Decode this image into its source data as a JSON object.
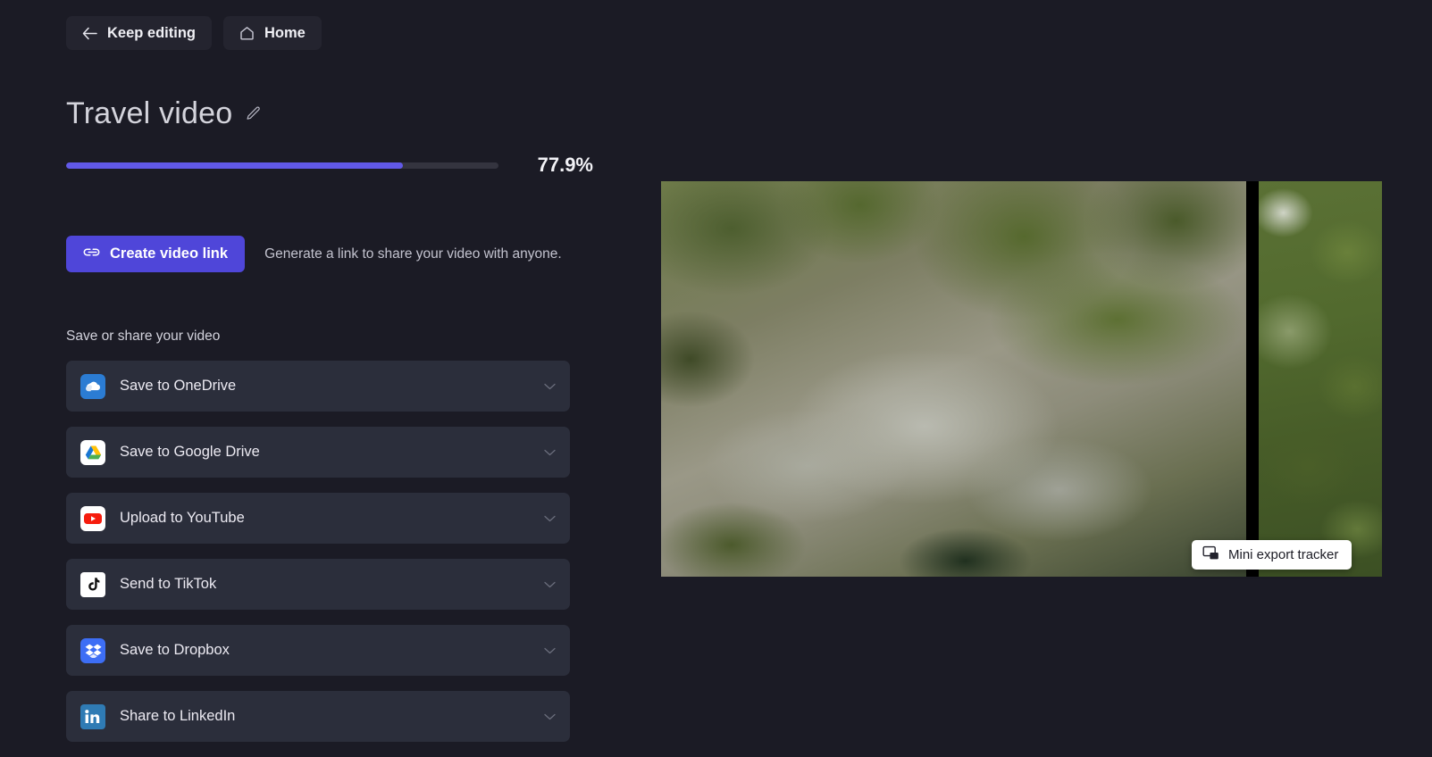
{
  "topbar": {
    "buttons": [
      {
        "label": "Keep editing",
        "icon": "arrow-left-icon"
      },
      {
        "label": "Home",
        "icon": "home-icon"
      }
    ]
  },
  "project": {
    "title": "Travel video",
    "edit_icon": "pencil-icon"
  },
  "progress": {
    "percent_label": "77.9%",
    "percent_value": 77.9,
    "fill_color": "#6159e8",
    "track_color": "#34343f"
  },
  "share_link": {
    "button_label": "Create video link",
    "button_icon": "link-icon",
    "button_color": "#4f46d9",
    "description": "Generate a link to share your video with anyone."
  },
  "share_section": {
    "label": "Save or share your video",
    "items": [
      {
        "label": "Save to OneDrive",
        "icon": "onedrive-icon",
        "chevron": "chevron-down-icon"
      },
      {
        "label": "Save to Google Drive",
        "icon": "googledrive-icon",
        "chevron": "chevron-down-icon"
      },
      {
        "label": "Upload to YouTube",
        "icon": "youtube-icon",
        "chevron": "chevron-down-icon"
      },
      {
        "label": "Send to TikTok",
        "icon": "tiktok-icon",
        "chevron": "chevron-down-icon"
      },
      {
        "label": "Save to Dropbox",
        "icon": "dropbox-icon",
        "chevron": "chevron-down-icon"
      },
      {
        "label": "Share to LinkedIn",
        "icon": "linkedin-icon",
        "chevron": "chevron-down-icon"
      }
    ]
  },
  "preview": {
    "description": "Video preview frame showing a rocky forested canyon with a stream"
  },
  "mini_tracker": {
    "label": "Mini export tracker",
    "icon": "picture-in-picture-icon"
  },
  "theme": {
    "background": "#1b1b25",
    "card": "#2b2e3b",
    "button": "#24242f",
    "accent": "#4f46d9"
  }
}
